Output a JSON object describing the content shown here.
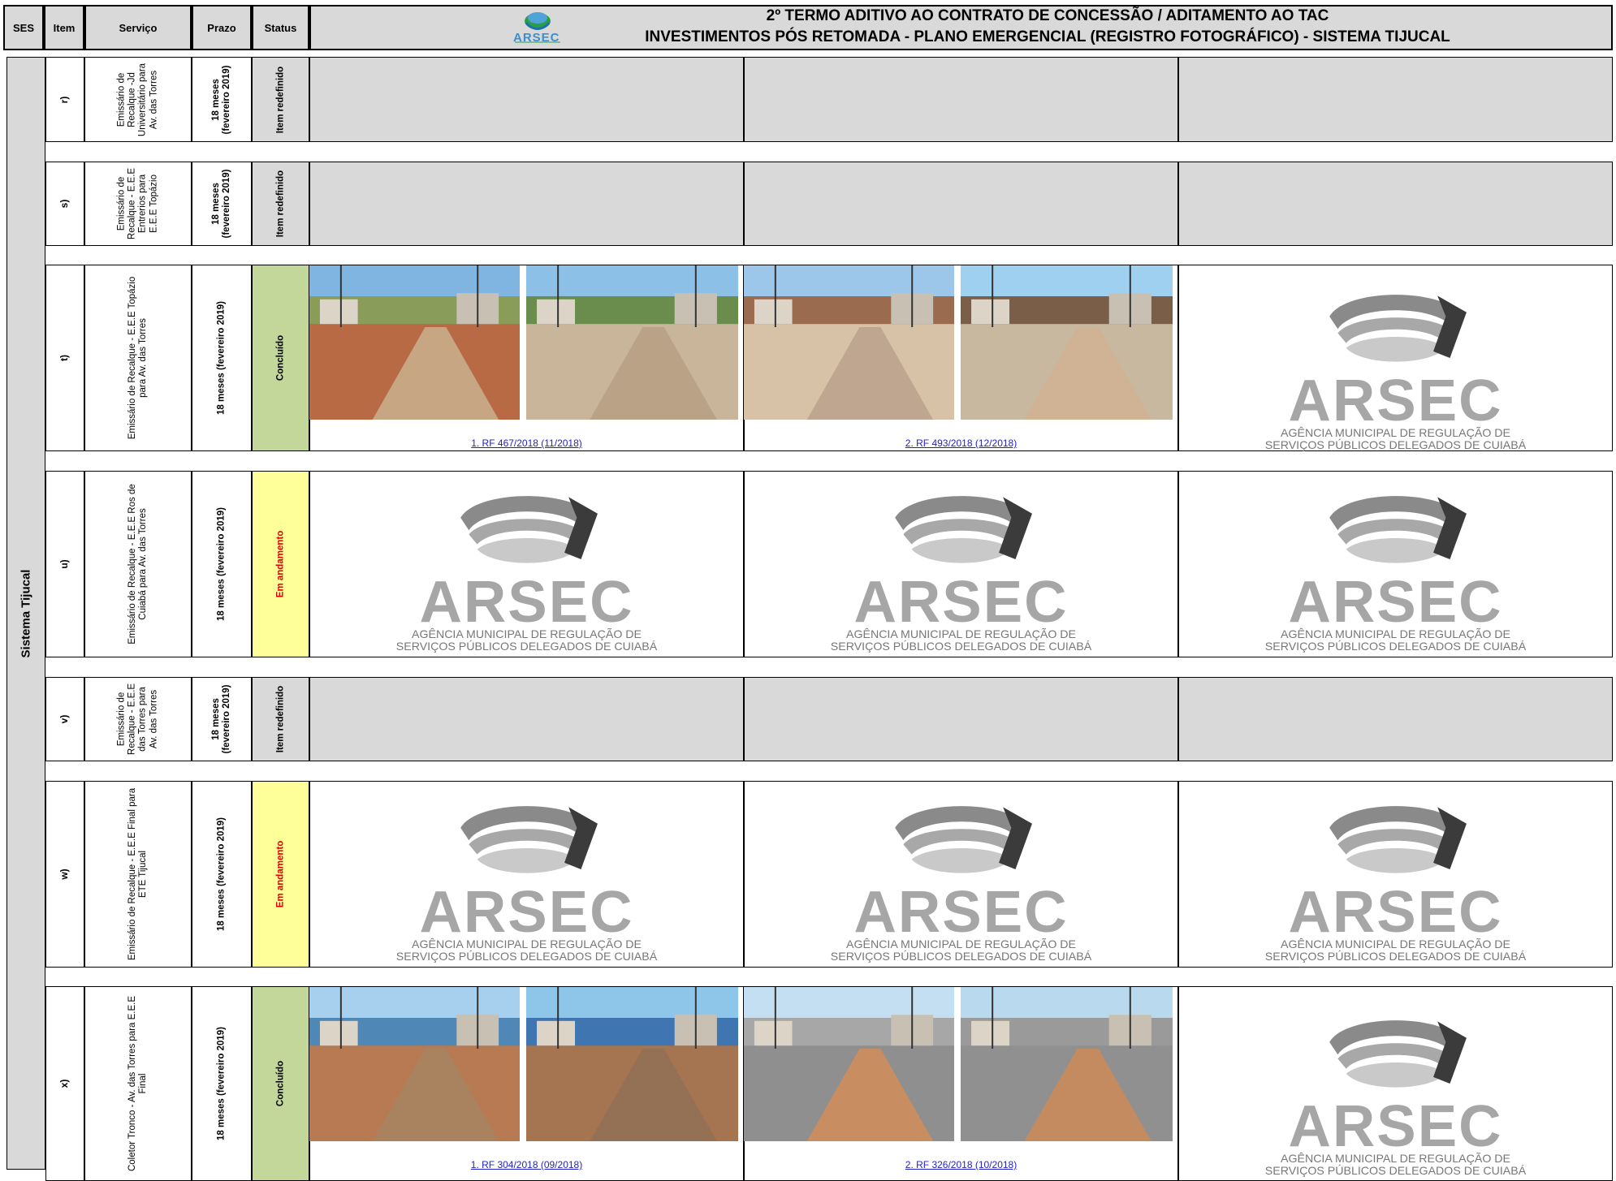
{
  "header": {
    "cols": {
      "ses": "SES",
      "item": "Item",
      "servico": "Serviço",
      "prazo": "Prazo",
      "status": "Status"
    },
    "title_line1": "2º TERMO ADITIVO AO CONTRATO DE CONCESSÃO / ADITAMENTO AO TAC",
    "title_line2": "INVESTIMENTOS PÓS RETOMADA - PLANO EMERGENCIAL (REGISTRO FOTOGRÁFICO) - SISTEMA TIJUCAL",
    "logo_text": "ARSEC"
  },
  "ses_label": "Sistema Tijucal",
  "logo": {
    "name": "ARSEC",
    "subtitle1": "AGÊNCIA MUNICIPAL DE REGULAÇÃO DE",
    "subtitle2": "SERVIÇOS PÚBLICOS DELEGADOS DE CUIABÁ"
  },
  "rows": [
    {
      "item": "r)",
      "servico": "Emissário de Recalque -Jd Universitário para Av. das Torres",
      "prazo": "18 meses (fevereiro 2019)",
      "status": "Item redefinido"
    },
    {
      "item": "s)",
      "servico": "Emissário de Recalque - E.E.E Entrerios para E.E.E Topázio",
      "prazo": "18 meses (fevereiro 2019)",
      "status": "Item redefinido"
    },
    {
      "item": "t)",
      "servico": "Emissário de Recalque - E.E.E Topázio para Av. das Torres",
      "prazo": "18 meses (fevereiro 2019)",
      "status": "Concluído",
      "caption1": "1. RF 467/2018 (11/2018)",
      "caption2": "2. RF 493/2018 (12/2018)"
    },
    {
      "item": "u)",
      "servico": "Emissário de Recalque - E.E.E Ros de Cuiabá para Av. das Torres",
      "prazo": "18 meses (fevereiro 2019)",
      "status": "Em andamento"
    },
    {
      "item": "v)",
      "servico": "Emissário de Recalque - E.E.E das Torres para Av. das Torres",
      "prazo": "18 meses (fevereiro 2019)",
      "status": "Item redefinido"
    },
    {
      "item": "w)",
      "servico": "Emissário de Recalque - E.E.E Final para ETE Tijucal",
      "prazo": "18 meses (fevereiro 2019)",
      "status": "Em andamento"
    },
    {
      "item": "x)",
      "servico": "Coletor Tronco - Av. das Torres para E.E.E Final",
      "prazo": "18 meses (fevereiro 2019)",
      "status": "Concluído",
      "caption1": "1. RF 304/2018 (09/2018)",
      "caption2": "2. RF 326/2018 (10/2018)"
    }
  ],
  "colors": {
    "header_gray": "#d9d9d9",
    "concluido": "#c4d79b",
    "andamento": "#ffff99",
    "status_red": "#e00000",
    "link_blue": "#1f1fc8"
  }
}
